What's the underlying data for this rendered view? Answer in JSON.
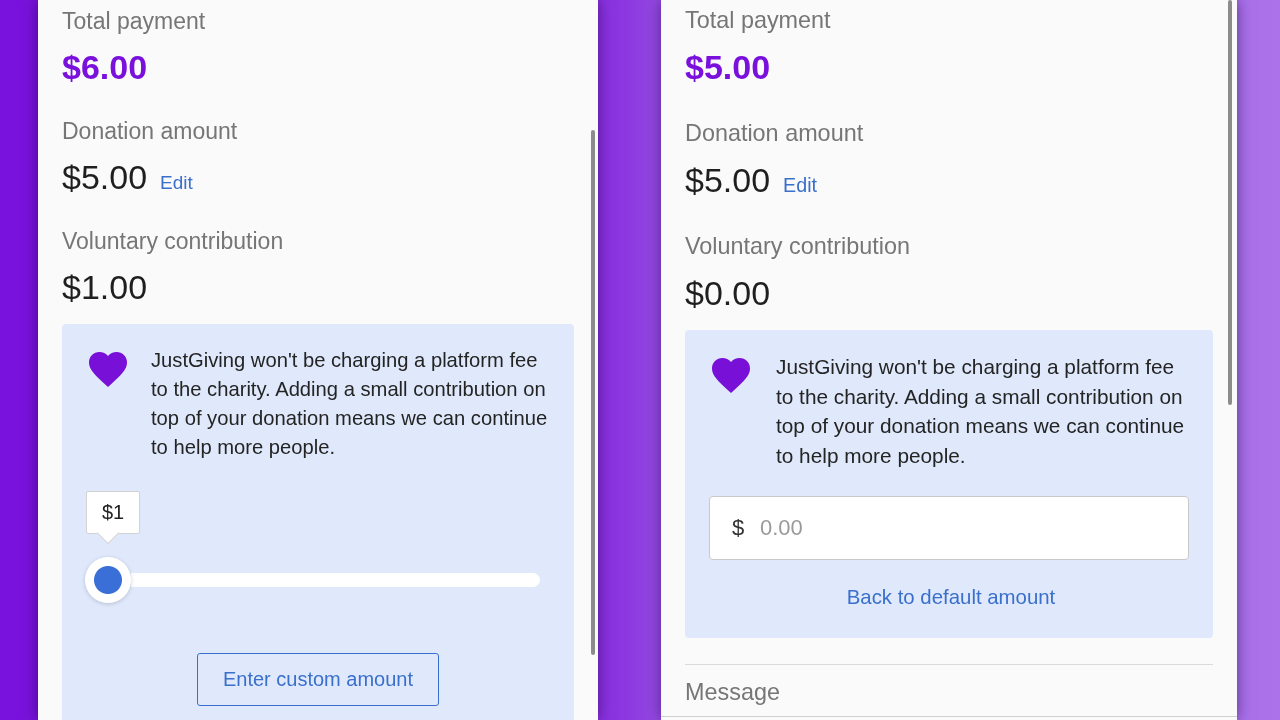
{
  "screens": [
    {
      "total_payment": {
        "label": "Total payment",
        "value": "$6.00"
      },
      "donation_amount": {
        "label": "Donation amount",
        "value": "$5.00",
        "edit_link": "Edit"
      },
      "voluntary_contribution": {
        "label": "Voluntary contribution",
        "value": "$1.00"
      },
      "contribution_card": {
        "kind": "slider",
        "message": "JustGiving won't be charging a platform fee to the charity. Adding a small contribution on top of your donation means we can continue to help more people.",
        "slider": {
          "tooltip": "$1",
          "level": 0
        },
        "button": "Enter custom amount"
      }
    },
    {
      "total_payment": {
        "label": "Total payment",
        "value": "$5.00"
      },
      "donation_amount": {
        "label": "Donation amount",
        "value": "$5.00",
        "edit_link": "Edit"
      },
      "voluntary_contribution": {
        "label": "Voluntary contribution",
        "value": "$0.00"
      },
      "contribution_card": {
        "kind": "custom",
        "message": "JustGiving won't be charging a platform fee to the charity. Adding a small contribution on top of your donation means we can continue to help more people.",
        "amount_field": {
          "prefix": "$",
          "placeholder": "0.00"
        },
        "link": "Back to default amount"
      },
      "message_section": {
        "label": "Message"
      }
    }
  ]
}
